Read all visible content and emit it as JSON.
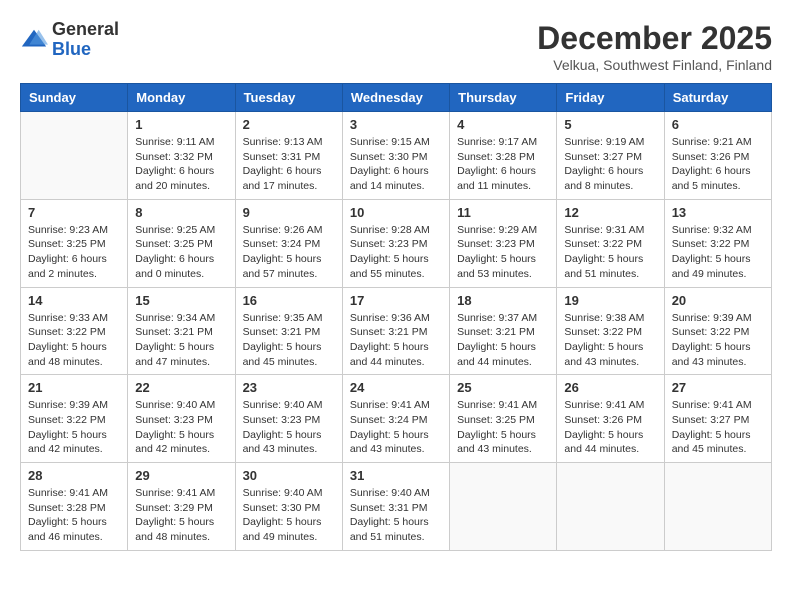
{
  "header": {
    "logo_general": "General",
    "logo_blue": "Blue",
    "title": "December 2025",
    "location": "Velkua, Southwest Finland, Finland"
  },
  "days_of_week": [
    "Sunday",
    "Monday",
    "Tuesday",
    "Wednesday",
    "Thursday",
    "Friday",
    "Saturday"
  ],
  "weeks": [
    [
      {
        "day": "",
        "info": ""
      },
      {
        "day": "1",
        "info": "Sunrise: 9:11 AM\nSunset: 3:32 PM\nDaylight: 6 hours\nand 20 minutes."
      },
      {
        "day": "2",
        "info": "Sunrise: 9:13 AM\nSunset: 3:31 PM\nDaylight: 6 hours\nand 17 minutes."
      },
      {
        "day": "3",
        "info": "Sunrise: 9:15 AM\nSunset: 3:30 PM\nDaylight: 6 hours\nand 14 minutes."
      },
      {
        "day": "4",
        "info": "Sunrise: 9:17 AM\nSunset: 3:28 PM\nDaylight: 6 hours\nand 11 minutes."
      },
      {
        "day": "5",
        "info": "Sunrise: 9:19 AM\nSunset: 3:27 PM\nDaylight: 6 hours\nand 8 minutes."
      },
      {
        "day": "6",
        "info": "Sunrise: 9:21 AM\nSunset: 3:26 PM\nDaylight: 6 hours\nand 5 minutes."
      }
    ],
    [
      {
        "day": "7",
        "info": "Sunrise: 9:23 AM\nSunset: 3:25 PM\nDaylight: 6 hours\nand 2 minutes."
      },
      {
        "day": "8",
        "info": "Sunrise: 9:25 AM\nSunset: 3:25 PM\nDaylight: 6 hours\nand 0 minutes."
      },
      {
        "day": "9",
        "info": "Sunrise: 9:26 AM\nSunset: 3:24 PM\nDaylight: 5 hours\nand 57 minutes."
      },
      {
        "day": "10",
        "info": "Sunrise: 9:28 AM\nSunset: 3:23 PM\nDaylight: 5 hours\nand 55 minutes."
      },
      {
        "day": "11",
        "info": "Sunrise: 9:29 AM\nSunset: 3:23 PM\nDaylight: 5 hours\nand 53 minutes."
      },
      {
        "day": "12",
        "info": "Sunrise: 9:31 AM\nSunset: 3:22 PM\nDaylight: 5 hours\nand 51 minutes."
      },
      {
        "day": "13",
        "info": "Sunrise: 9:32 AM\nSunset: 3:22 PM\nDaylight: 5 hours\nand 49 minutes."
      }
    ],
    [
      {
        "day": "14",
        "info": "Sunrise: 9:33 AM\nSunset: 3:22 PM\nDaylight: 5 hours\nand 48 minutes."
      },
      {
        "day": "15",
        "info": "Sunrise: 9:34 AM\nSunset: 3:21 PM\nDaylight: 5 hours\nand 47 minutes."
      },
      {
        "day": "16",
        "info": "Sunrise: 9:35 AM\nSunset: 3:21 PM\nDaylight: 5 hours\nand 45 minutes."
      },
      {
        "day": "17",
        "info": "Sunrise: 9:36 AM\nSunset: 3:21 PM\nDaylight: 5 hours\nand 44 minutes."
      },
      {
        "day": "18",
        "info": "Sunrise: 9:37 AM\nSunset: 3:21 PM\nDaylight: 5 hours\nand 44 minutes."
      },
      {
        "day": "19",
        "info": "Sunrise: 9:38 AM\nSunset: 3:22 PM\nDaylight: 5 hours\nand 43 minutes."
      },
      {
        "day": "20",
        "info": "Sunrise: 9:39 AM\nSunset: 3:22 PM\nDaylight: 5 hours\nand 43 minutes."
      }
    ],
    [
      {
        "day": "21",
        "info": "Sunrise: 9:39 AM\nSunset: 3:22 PM\nDaylight: 5 hours\nand 42 minutes."
      },
      {
        "day": "22",
        "info": "Sunrise: 9:40 AM\nSunset: 3:23 PM\nDaylight: 5 hours\nand 42 minutes."
      },
      {
        "day": "23",
        "info": "Sunrise: 9:40 AM\nSunset: 3:23 PM\nDaylight: 5 hours\nand 43 minutes."
      },
      {
        "day": "24",
        "info": "Sunrise: 9:41 AM\nSunset: 3:24 PM\nDaylight: 5 hours\nand 43 minutes."
      },
      {
        "day": "25",
        "info": "Sunrise: 9:41 AM\nSunset: 3:25 PM\nDaylight: 5 hours\nand 43 minutes."
      },
      {
        "day": "26",
        "info": "Sunrise: 9:41 AM\nSunset: 3:26 PM\nDaylight: 5 hours\nand 44 minutes."
      },
      {
        "day": "27",
        "info": "Sunrise: 9:41 AM\nSunset: 3:27 PM\nDaylight: 5 hours\nand 45 minutes."
      }
    ],
    [
      {
        "day": "28",
        "info": "Sunrise: 9:41 AM\nSunset: 3:28 PM\nDaylight: 5 hours\nand 46 minutes."
      },
      {
        "day": "29",
        "info": "Sunrise: 9:41 AM\nSunset: 3:29 PM\nDaylight: 5 hours\nand 48 minutes."
      },
      {
        "day": "30",
        "info": "Sunrise: 9:40 AM\nSunset: 3:30 PM\nDaylight: 5 hours\nand 49 minutes."
      },
      {
        "day": "31",
        "info": "Sunrise: 9:40 AM\nSunset: 3:31 PM\nDaylight: 5 hours\nand 51 minutes."
      },
      {
        "day": "",
        "info": ""
      },
      {
        "day": "",
        "info": ""
      },
      {
        "day": "",
        "info": ""
      }
    ]
  ]
}
